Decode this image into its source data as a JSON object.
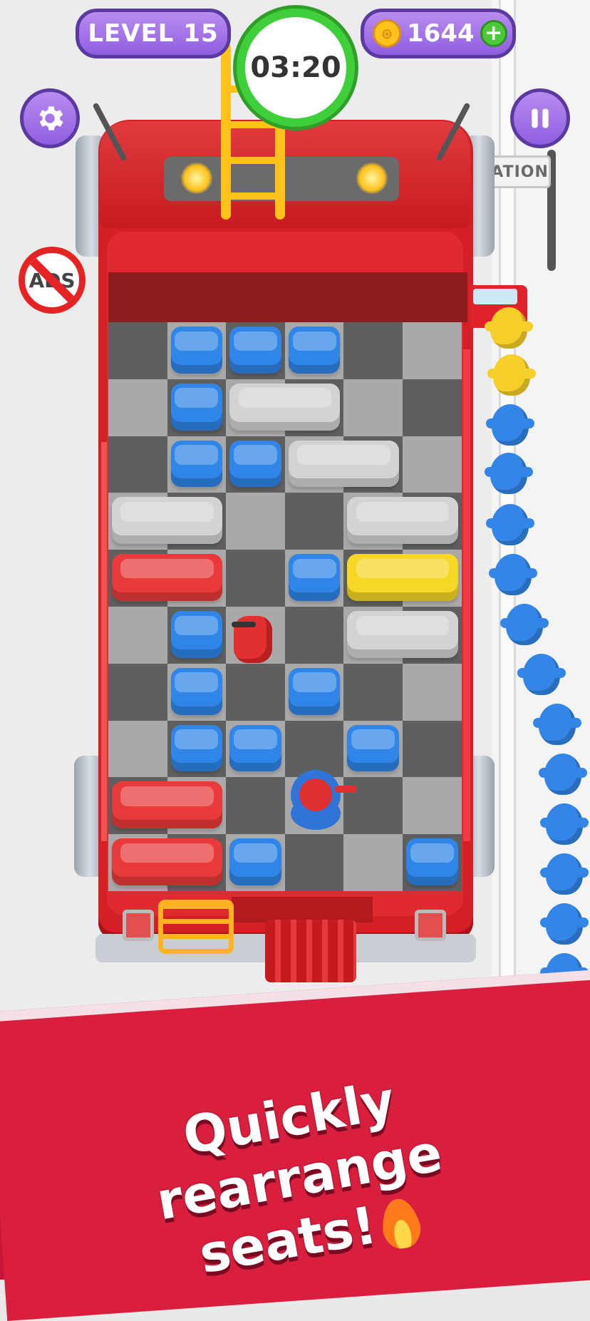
{
  "hud": {
    "level_label": "LEVEL 15",
    "timer": "03:20",
    "coins": "1644",
    "coin_glyph": "⊛",
    "add_coins_glyph": "+",
    "settings_icon": "gear-icon",
    "pause_icon": "pause-icon",
    "no_ads_text": "ADS"
  },
  "scene": {
    "station_sign": "STATION"
  },
  "board": {
    "columns": 6,
    "rows": 10,
    "seats": [
      {
        "color": "blue",
        "col": 1,
        "row": 0,
        "w": 1
      },
      {
        "color": "blue",
        "col": 2,
        "row": 0,
        "w": 1
      },
      {
        "color": "blue",
        "col": 3,
        "row": 0,
        "w": 1
      },
      {
        "color": "blue",
        "col": 1,
        "row": 1,
        "w": 1
      },
      {
        "color": "gray",
        "col": 2,
        "row": 1,
        "w": 2
      },
      {
        "color": "blue",
        "col": 1,
        "row": 2,
        "w": 1
      },
      {
        "color": "blue",
        "col": 2,
        "row": 2,
        "w": 1
      },
      {
        "color": "gray",
        "col": 3,
        "row": 2,
        "w": 2
      },
      {
        "color": "gray",
        "col": 0,
        "row": 3,
        "w": 2
      },
      {
        "color": "gray",
        "col": 4,
        "row": 3,
        "w": 2
      },
      {
        "color": "red",
        "col": 0,
        "row": 4,
        "w": 2
      },
      {
        "color": "blue",
        "col": 3,
        "row": 4,
        "w": 1
      },
      {
        "color": "yellow",
        "col": 4,
        "row": 4,
        "w": 2
      },
      {
        "color": "blue",
        "col": 1,
        "row": 5,
        "w": 1
      },
      {
        "color": "gray",
        "col": 4,
        "row": 5,
        "w": 2
      },
      {
        "color": "blue",
        "col": 1,
        "row": 6,
        "w": 1
      },
      {
        "color": "blue",
        "col": 3,
        "row": 6,
        "w": 1
      },
      {
        "color": "blue",
        "col": 1,
        "row": 7,
        "w": 1
      },
      {
        "color": "blue",
        "col": 2,
        "row": 7,
        "w": 1
      },
      {
        "color": "blue",
        "col": 4,
        "row": 7,
        "w": 1
      },
      {
        "color": "red",
        "col": 0,
        "row": 8,
        "w": 2
      },
      {
        "color": "red",
        "col": 0,
        "row": 9,
        "w": 2
      },
      {
        "color": "blue",
        "col": 2,
        "row": 9,
        "w": 1
      },
      {
        "color": "blue",
        "col": 5,
        "row": 9,
        "w": 1
      }
    ],
    "obstacles": [
      {
        "type": "fire-extinguisher",
        "col": 2,
        "row": 5
      },
      {
        "type": "hose-reel",
        "col": 3,
        "row": 8
      }
    ]
  },
  "queue": {
    "passengers": [
      "yellow",
      "yellow",
      "blue",
      "blue",
      "blue",
      "blue",
      "blue",
      "blue",
      "blue",
      "blue",
      "blue",
      "blue",
      "blue",
      "blue",
      "blue",
      "blue",
      "blue",
      "blue"
    ]
  },
  "colors": {
    "blue": "#2f86e8",
    "gray": "#d3d3d3",
    "red": "#e83a3a",
    "yellow": "#f7d726",
    "hud_purple": "#8f5ee0",
    "timer_green": "#3fcf3a",
    "banner_red": "#d91e3e"
  },
  "banner": {
    "line1": "Quickly rearrange",
    "line2": "seats!",
    "emoji_icon": "flame-icon"
  }
}
